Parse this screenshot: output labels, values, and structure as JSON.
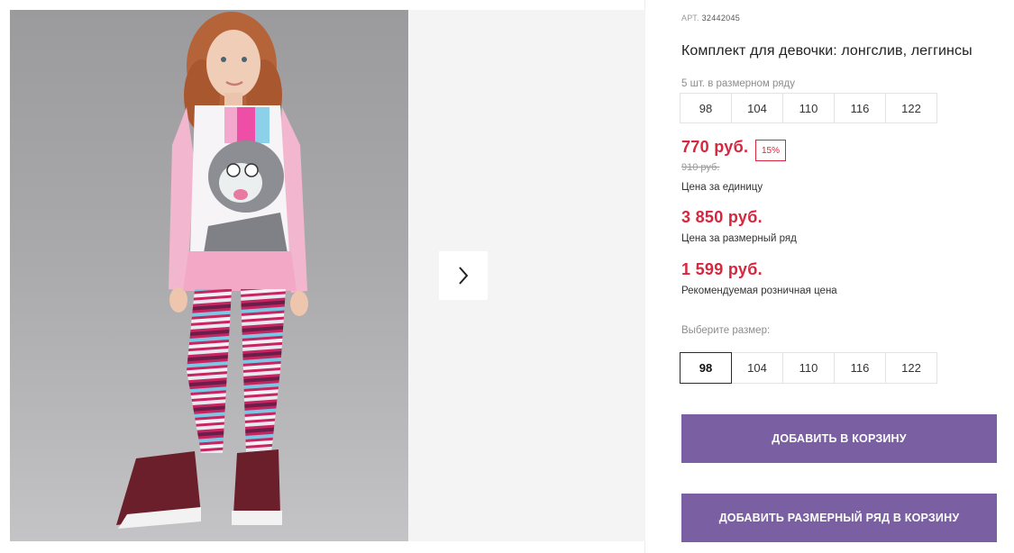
{
  "gallery": {
    "next_icon": "chevron-right-icon"
  },
  "product": {
    "art_label": "АРТ.",
    "art_number": "32442045",
    "title": "Комплект для девочки: лонгслив, леггинсы"
  },
  "pack": {
    "note": "5 шт. в размерном ряду",
    "sizes": [
      "98",
      "104",
      "110",
      "116",
      "122"
    ]
  },
  "pricing": {
    "unit_price": "770 руб.",
    "discount": "15%",
    "old_price": "910 руб.",
    "unit_caption": "Цена за единицу",
    "pack_price": "3 850 руб.",
    "pack_caption": "Цена за размерный ряд",
    "retail_price": "1 599 руб.",
    "retail_caption": "Рекомендуемая розничная цена"
  },
  "size_select": {
    "label": "Выберите размер:",
    "options": [
      "98",
      "104",
      "110",
      "116",
      "122"
    ],
    "selected": "98"
  },
  "actions": {
    "add_to_cart": "ДОБАВИТЬ В КОРЗИНУ",
    "add_pack_to_cart": "ДОБАВИТЬ РАЗМЕРНЫЙ РЯД В КОРЗИНУ"
  },
  "colors": {
    "price_red": "#d7263d",
    "button_purple": "#7a60a3"
  }
}
